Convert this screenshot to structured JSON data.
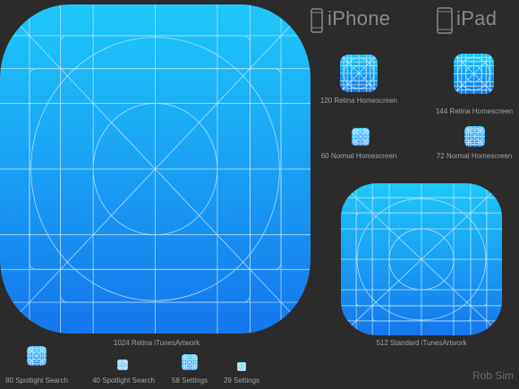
{
  "headers": {
    "iphone": "iPhone",
    "ipad": "iPad"
  },
  "icons": [
    {
      "id": "icon-1024",
      "caption": "1024 Retina iTunesArtwork"
    },
    {
      "id": "icon-512",
      "caption": "512 Standard iTunesArtwork"
    },
    {
      "id": "icon-120",
      "caption": "120 Retina Homescreen"
    },
    {
      "id": "icon-144",
      "caption": "144 Retina Homescreen"
    },
    {
      "id": "icon-60",
      "caption": "60 Normal Homescreen"
    },
    {
      "id": "icon-72",
      "caption": "72 Normal Homescreen"
    },
    {
      "id": "icon-80",
      "caption": "80 Spotlight Search"
    },
    {
      "id": "icon-40",
      "caption": "40 Spotlight Search"
    },
    {
      "id": "icon-58",
      "caption": "58 Settings"
    },
    {
      "id": "icon-29",
      "caption": "29 Settings"
    }
  ],
  "credit": "Rob Sim",
  "colors": {
    "background": "#2b2b2b",
    "gradient_top": "#1ec9fb",
    "gradient_bottom": "#1576ed",
    "grid_lines": "#bfe6fb"
  }
}
